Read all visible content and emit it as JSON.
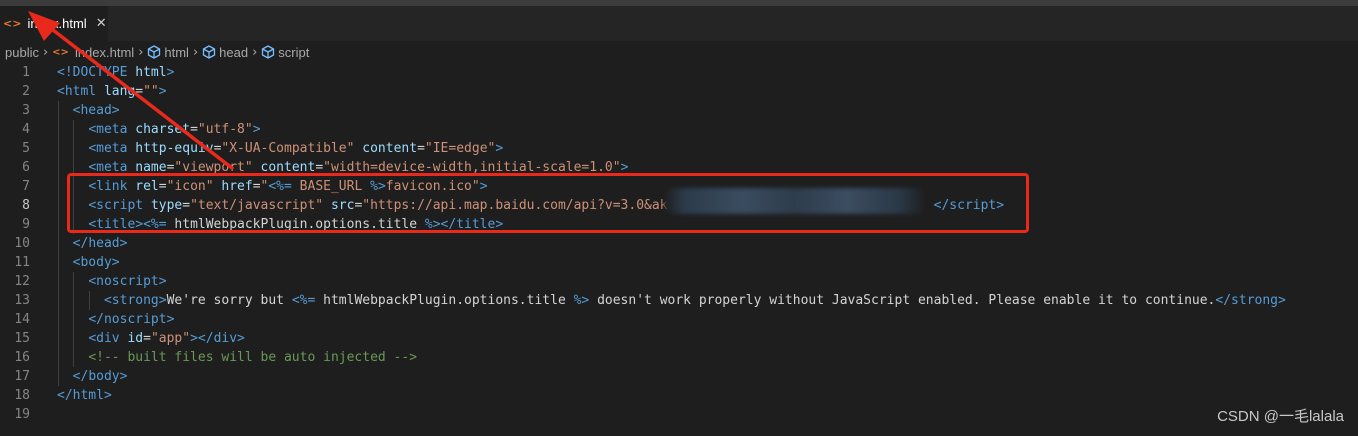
{
  "tab": {
    "label": "index.html",
    "icon": "<>",
    "close": "✕"
  },
  "breadcrumb": {
    "items": [
      "public",
      "index.html",
      "html",
      "head",
      "script"
    ],
    "sep": "›"
  },
  "lines": [
    {
      "n": "1",
      "toks": [
        [
          "<!DOCTYPE",
          "t"
        ],
        [
          " ",
          "p"
        ],
        [
          "html",
          "a"
        ],
        [
          ">",
          "t"
        ]
      ]
    },
    {
      "n": "2",
      "toks": [
        [
          "<",
          "t"
        ],
        [
          "html",
          "t"
        ],
        [
          " ",
          "p"
        ],
        [
          "lang",
          "a"
        ],
        [
          "=",
          "p"
        ],
        [
          "\"\"",
          "s"
        ],
        [
          ">",
          "t"
        ]
      ]
    },
    {
      "n": "3",
      "toks": [
        [
          "  ",
          "p"
        ],
        [
          "<",
          "t"
        ],
        [
          "head",
          "t"
        ],
        [
          ">",
          "t"
        ]
      ]
    },
    {
      "n": "4",
      "toks": [
        [
          "    ",
          "p"
        ],
        [
          "<",
          "t"
        ],
        [
          "meta",
          "t"
        ],
        [
          " ",
          "p"
        ],
        [
          "charset",
          "a"
        ],
        [
          "=",
          "p"
        ],
        [
          "\"utf-8\"",
          "s"
        ],
        [
          ">",
          "t"
        ]
      ]
    },
    {
      "n": "5",
      "toks": [
        [
          "    ",
          "p"
        ],
        [
          "<",
          "t"
        ],
        [
          "meta",
          "t"
        ],
        [
          " ",
          "p"
        ],
        [
          "http-equiv",
          "a"
        ],
        [
          "=",
          "p"
        ],
        [
          "\"X-UA-Compatible\"",
          "s"
        ],
        [
          " ",
          "p"
        ],
        [
          "content",
          "a"
        ],
        [
          "=",
          "p"
        ],
        [
          "\"IE=edge\"",
          "s"
        ],
        [
          ">",
          "t"
        ]
      ]
    },
    {
      "n": "6",
      "toks": [
        [
          "    ",
          "p"
        ],
        [
          "<",
          "t"
        ],
        [
          "meta",
          "t"
        ],
        [
          " ",
          "p"
        ],
        [
          "name",
          "a"
        ],
        [
          "=",
          "p"
        ],
        [
          "\"viewport\"",
          "s"
        ],
        [
          " ",
          "p"
        ],
        [
          "content",
          "a"
        ],
        [
          "=",
          "p"
        ],
        [
          "\"width=device-width,initial-scale=1.0\"",
          "s"
        ],
        [
          ">",
          "t"
        ]
      ]
    },
    {
      "n": "7",
      "toks": [
        [
          "    ",
          "p"
        ],
        [
          "<",
          "t"
        ],
        [
          "link",
          "t"
        ],
        [
          " ",
          "p"
        ],
        [
          "rel",
          "a"
        ],
        [
          "=",
          "p"
        ],
        [
          "\"icon\"",
          "s"
        ],
        [
          " ",
          "p"
        ],
        [
          "href",
          "a"
        ],
        [
          "=",
          "p"
        ],
        [
          "\"",
          "s"
        ],
        [
          "<%=",
          "t"
        ],
        [
          " BASE_URL ",
          "s"
        ],
        [
          "%>",
          "t"
        ],
        [
          "favicon.ico\"",
          "s"
        ],
        [
          ">",
          "t"
        ]
      ]
    },
    {
      "n": "8",
      "toks": [
        [
          "    ",
          "p"
        ],
        [
          "<",
          "t"
        ],
        [
          "script",
          "t"
        ],
        [
          " ",
          "p"
        ],
        [
          "type",
          "a"
        ],
        [
          "=",
          "p"
        ],
        [
          "\"text/javascript\"",
          "s"
        ],
        [
          " ",
          "p"
        ],
        [
          "src",
          "a"
        ],
        [
          "=",
          "p"
        ],
        [
          "\"https://api.map.baidu.com/api?v=3.0&ak=",
          "s"
        ],
        [
          "                                 ",
          "p"
        ],
        [
          "</",
          "t"
        ],
        [
          "script",
          "t"
        ],
        [
          ">",
          "t"
        ]
      ]
    },
    {
      "n": "9",
      "toks": [
        [
          "    ",
          "p"
        ],
        [
          "<",
          "t"
        ],
        [
          "title",
          "t"
        ],
        [
          ">",
          "t"
        ],
        [
          "<%=",
          "t"
        ],
        [
          " htmlWebpackPlugin.options.title ",
          "p"
        ],
        [
          "%>",
          "t"
        ],
        [
          "</",
          "t"
        ],
        [
          "title",
          "t"
        ],
        [
          ">",
          "t"
        ]
      ]
    },
    {
      "n": "10",
      "toks": [
        [
          "  ",
          "p"
        ],
        [
          "</",
          "t"
        ],
        [
          "head",
          "t"
        ],
        [
          ">",
          "t"
        ]
      ]
    },
    {
      "n": "11",
      "toks": [
        [
          "  ",
          "p"
        ],
        [
          "<",
          "t"
        ],
        [
          "body",
          "t"
        ],
        [
          ">",
          "t"
        ]
      ]
    },
    {
      "n": "12",
      "toks": [
        [
          "    ",
          "p"
        ],
        [
          "<",
          "t"
        ],
        [
          "noscript",
          "t"
        ],
        [
          ">",
          "t"
        ]
      ]
    },
    {
      "n": "13",
      "toks": [
        [
          "      ",
          "p"
        ],
        [
          "<",
          "t"
        ],
        [
          "strong",
          "t"
        ],
        [
          ">",
          "t"
        ],
        [
          "We're sorry but ",
          "p"
        ],
        [
          "<%=",
          "t"
        ],
        [
          " htmlWebpackPlugin.options.title ",
          "p"
        ],
        [
          "%>",
          "t"
        ],
        [
          " doesn't work properly without JavaScript enabled. Please enable it to continue.",
          "p"
        ],
        [
          "</",
          "t"
        ],
        [
          "strong",
          "t"
        ],
        [
          ">",
          "t"
        ]
      ]
    },
    {
      "n": "14",
      "toks": [
        [
          "    ",
          "p"
        ],
        [
          "</",
          "t"
        ],
        [
          "noscript",
          "t"
        ],
        [
          ">",
          "t"
        ]
      ]
    },
    {
      "n": "15",
      "toks": [
        [
          "    ",
          "p"
        ],
        [
          "<",
          "t"
        ],
        [
          "div",
          "t"
        ],
        [
          " ",
          "p"
        ],
        [
          "id",
          "a"
        ],
        [
          "=",
          "p"
        ],
        [
          "\"app\"",
          "s"
        ],
        [
          ">",
          "t"
        ],
        [
          "</",
          "t"
        ],
        [
          "div",
          "t"
        ],
        [
          ">",
          "t"
        ]
      ]
    },
    {
      "n": "16",
      "toks": [
        [
          "    ",
          "p"
        ],
        [
          "<!-- built files will be auto injected -->",
          "c"
        ]
      ]
    },
    {
      "n": "17",
      "toks": [
        [
          "  ",
          "p"
        ],
        [
          "</",
          "t"
        ],
        [
          "body",
          "t"
        ],
        [
          ">",
          "t"
        ]
      ]
    },
    {
      "n": "18",
      "toks": [
        [
          "</",
          "t"
        ],
        [
          "html",
          "t"
        ],
        [
          ">",
          "t"
        ]
      ]
    },
    {
      "n": "19",
      "toks": []
    }
  ],
  "active_line": 8,
  "colors": {
    "t": "#569cd6",
    "a": "#9cdcfe",
    "s": "#ce9178",
    "c": "#6a9955",
    "p": "#d4d4d4",
    "annotation": "#e8291c"
  },
  "watermark": "CSDN @一毛lalala"
}
